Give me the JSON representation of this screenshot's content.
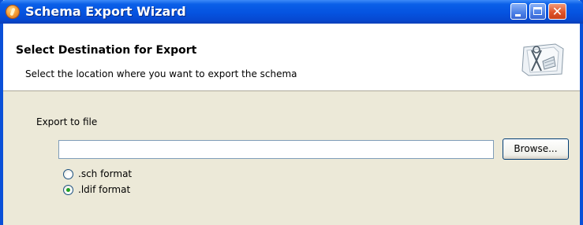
{
  "window": {
    "title": "Schema Export Wizard"
  },
  "header": {
    "title": "Select Destination for Export",
    "description": "Select the location where you want to export the schema"
  },
  "export": {
    "label": "Export to file",
    "file_value": "",
    "browse_label": "Browse..."
  },
  "format_options": [
    {
      "label": ".sch format",
      "selected": false
    },
    {
      "label": ".ldif format",
      "selected": true
    }
  ],
  "icons": {
    "app": "wizard-app-icon",
    "header": "schema-export-graphic-icon",
    "minimize": "minimize-icon",
    "maximize": "maximize-icon",
    "close": "close-icon"
  }
}
